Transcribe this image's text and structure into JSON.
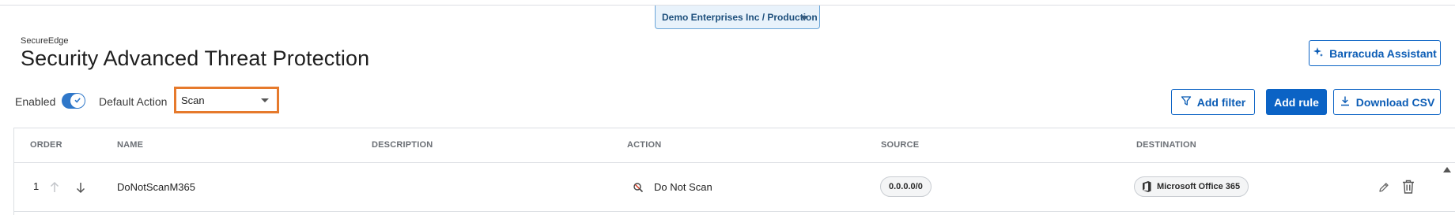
{
  "tenant_selector": {
    "label": "Demo Enterprises Inc / Production"
  },
  "header": {
    "brand": "SecureEdge",
    "title": "Security Advanced Threat Protection",
    "assistant_label": "Barracuda Assistant"
  },
  "toolbar": {
    "enabled_label": "Enabled",
    "enabled_on": true,
    "default_action_label": "Default Action",
    "default_action_value": "Scan",
    "add_filter_label": "Add filter",
    "add_rule_label": "Add rule",
    "download_csv_label": "Download CSV"
  },
  "table": {
    "columns": [
      "ORDER",
      "NAME",
      "DESCRIPTION",
      "ACTION",
      "SOURCE",
      "DESTINATION"
    ],
    "rows": [
      {
        "order": "1",
        "name": "DoNotScanM365",
        "description": "",
        "action": "Do Not Scan",
        "source": "0.0.0.0/0",
        "destination": "Microsoft Office 365"
      }
    ]
  },
  "colors": {
    "accent": "#0b63c5",
    "highlight_border": "#e67a2c",
    "tenant_bg": "#e8f2fb"
  },
  "icons": [
    "sparkle-icon",
    "filter-icon",
    "download-icon",
    "arrow-up-icon",
    "arrow-down-icon",
    "no-scan-icon",
    "office365-icon",
    "pencil-icon",
    "trash-icon",
    "check-icon"
  ]
}
